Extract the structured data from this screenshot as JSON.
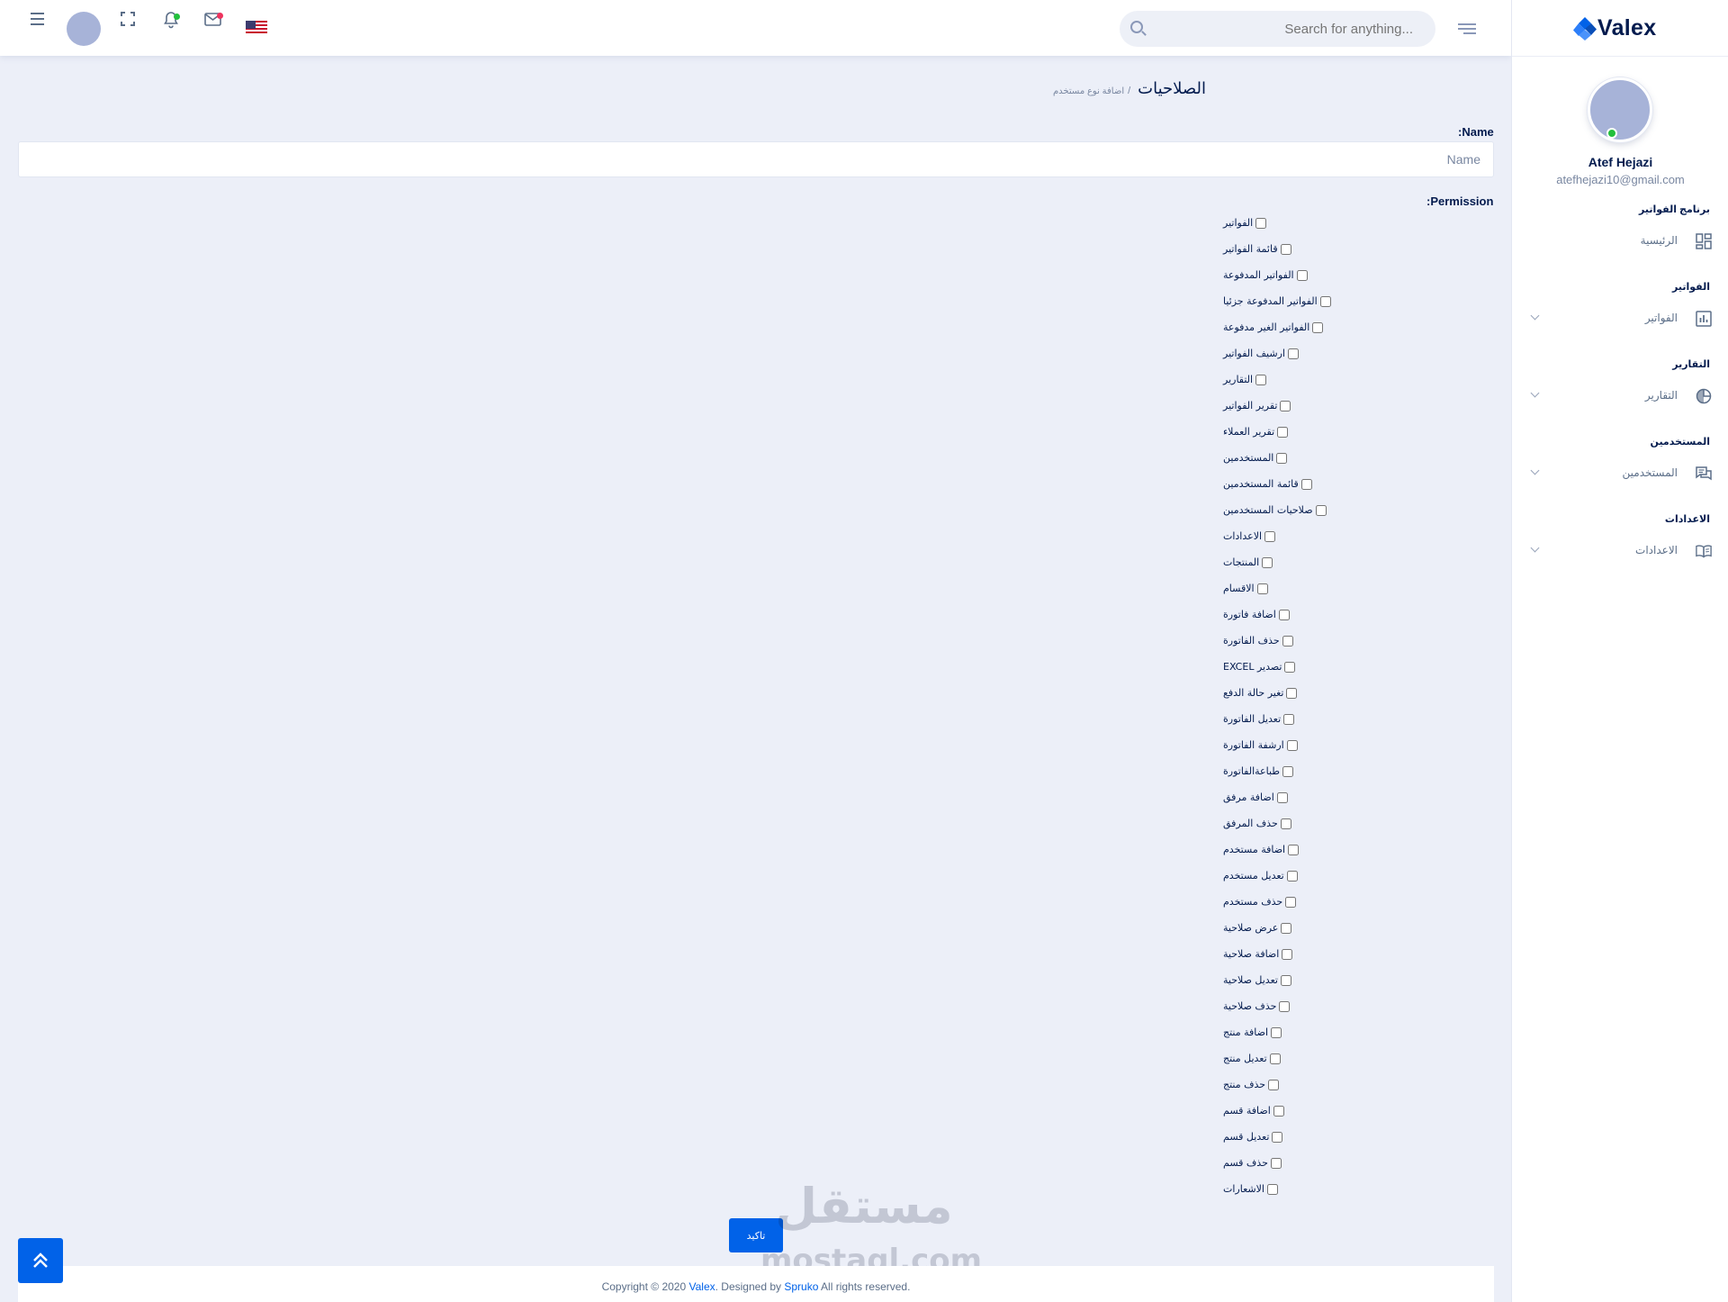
{
  "header": {
    "search_placeholder": "Search for anything..."
  },
  "sidebar": {
    "brand": "Valex",
    "user_name": "Atef Hejazi",
    "user_email": "atefhejazi10@gmail.com",
    "sections": [
      {
        "category": "برنامج الفواتير",
        "item": "الرئيسية",
        "icon": "dashboard-icon"
      },
      {
        "category": "الفواتير",
        "item": "الفواتير",
        "icon": "bar-chart-icon"
      },
      {
        "category": "التقارير",
        "item": "التقارير",
        "icon": "pie-chart-icon"
      },
      {
        "category": "المستخدمين",
        "item": "المستخدمين",
        "icon": "chat-icon"
      },
      {
        "category": "الاعدادات",
        "item": "الاعدادات",
        "icon": "book-icon"
      }
    ]
  },
  "main": {
    "page_title": "الصلاحيات",
    "breadcrumb_sub": "اضافة نوع مستخدم",
    "name_label": ":Name",
    "name_placeholder": "Name",
    "permission_label": ":Permission",
    "permissions": [
      "الفواتير",
      "قائمة الفواتير",
      "الفواتير المدفوعة",
      "الفواتير المدفوعة جزئيا",
      "الفواتير الغير مدفوعة",
      "ارشيف الفواتير",
      "التقارير",
      "تقرير الفواتير",
      "تقرير العملاء",
      "المستخدمين",
      "قائمة المستخدمين",
      "صلاحيات المستخدمين",
      "الاعدادات",
      "المنتجات",
      "الاقسام",
      "اضافة فاتورة",
      "حذف الفاتورة",
      "تصدير EXCEL",
      "تغير حالة الدفع",
      "تعديل الفاتورة",
      "ارشفة الفاتورة",
      "طباعةالفاتورة",
      "اضافة مرفق",
      "حذف المرفق",
      "اضافة مستخدم",
      "تعديل مستخدم",
      "حذف مستخدم",
      "عرض صلاحية",
      "اضافة صلاحية",
      "تعديل صلاحية",
      "حذف صلاحية",
      "اضافة منتج",
      "تعديل منتج",
      "حذف منتج",
      "اضافة قسم",
      "تعديل قسم",
      "حذف قسم",
      "الاشعارات"
    ],
    "submit_label": "تاكيد"
  },
  "watermark": {
    "arabic": "مستقل",
    "latin": "mostaql.com"
  },
  "footer": {
    "prefix": "Copyright © 2020 ",
    "brand": "Valex",
    "middle": ". Designed by ",
    "designer": "Spruko",
    "suffix": " All rights reserved."
  },
  "colors": {
    "primary": "#0162e8",
    "background": "#eceff8",
    "online": "#22c03c"
  }
}
